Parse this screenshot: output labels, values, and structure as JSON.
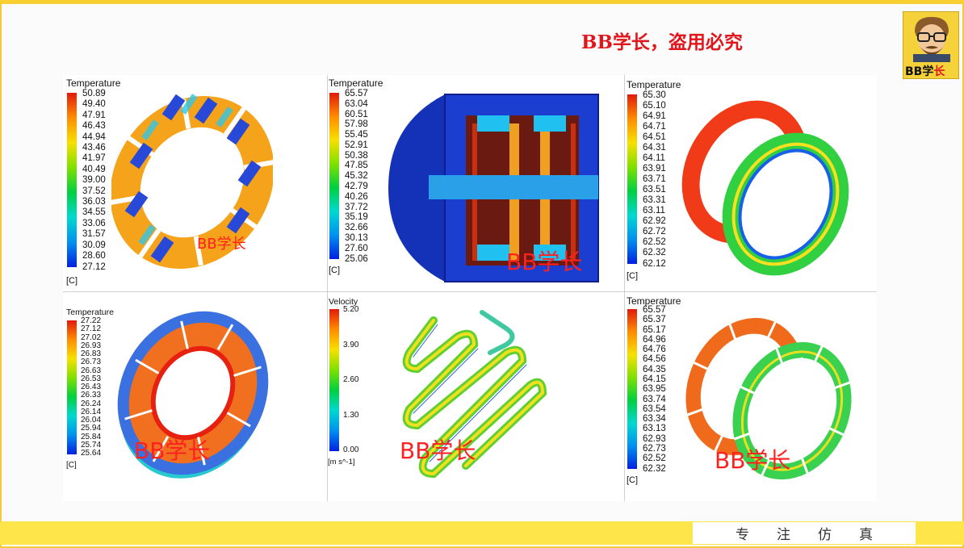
{
  "header": {
    "title": "BB学长，盗用必究",
    "logo_text_a": "BB学",
    "logo_text_b": "长"
  },
  "footer": {
    "text": "专注仿真"
  },
  "panels": [
    {
      "legend_title": "Temperature",
      "unit": "[C]",
      "values": [
        "50.89",
        "49.40",
        "47.91",
        "46.43",
        "44.94",
        "43.46",
        "41.97",
        "40.49",
        "39.00",
        "37.52",
        "36.03",
        "34.55",
        "33.06",
        "31.57",
        "30.09",
        "28.60",
        "27.12"
      ],
      "watermark": "BB学长"
    },
    {
      "legend_title": "Temperature",
      "unit": "[C]",
      "values": [
        "65.57",
        "63.04",
        "60.51",
        "57.98",
        "55.45",
        "52.91",
        "50.38",
        "47.85",
        "45.32",
        "42.79",
        "40.26",
        "37.72",
        "35.19",
        "32.66",
        "30.13",
        "27.60",
        "25.06"
      ],
      "watermark": "BB学长"
    },
    {
      "legend_title": "Temperature",
      "unit": "[C]",
      "values": [
        "65.30",
        "65.10",
        "64.91",
        "64.71",
        "64.51",
        "64.31",
        "64.11",
        "63.91",
        "63.71",
        "63.51",
        "63.31",
        "63.11",
        "62.92",
        "62.72",
        "62.52",
        "62.32",
        "62.12"
      ],
      "watermark": ""
    },
    {
      "legend_title": "Temperature",
      "unit": "[C]",
      "values": [
        "27.22",
        "27.12",
        "27.02",
        "26.93",
        "26.83",
        "26.73",
        "26.63",
        "26.53",
        "26.43",
        "26.33",
        "26.24",
        "26.14",
        "26.04",
        "25.94",
        "25.84",
        "25.74",
        "25.64"
      ],
      "watermark": "BB学长"
    },
    {
      "legend_title": "Velocity",
      "unit": "[m s^-1]",
      "values": [
        "5.20",
        "3.90",
        "2.60",
        "1.30",
        "0.00"
      ],
      "watermark": "BB学长"
    },
    {
      "legend_title": "Temperature",
      "unit": "[C]",
      "values": [
        "65.57",
        "65.37",
        "65.17",
        "64.96",
        "64.76",
        "64.56",
        "64.35",
        "64.15",
        "63.95",
        "63.74",
        "63.54",
        "63.34",
        "63.13",
        "62.93",
        "62.73",
        "62.52",
        "62.32"
      ],
      "watermark": "BB学长"
    }
  ],
  "colors": {
    "title_red": "#e0161c",
    "accent_yellow": "#f9cf34"
  }
}
